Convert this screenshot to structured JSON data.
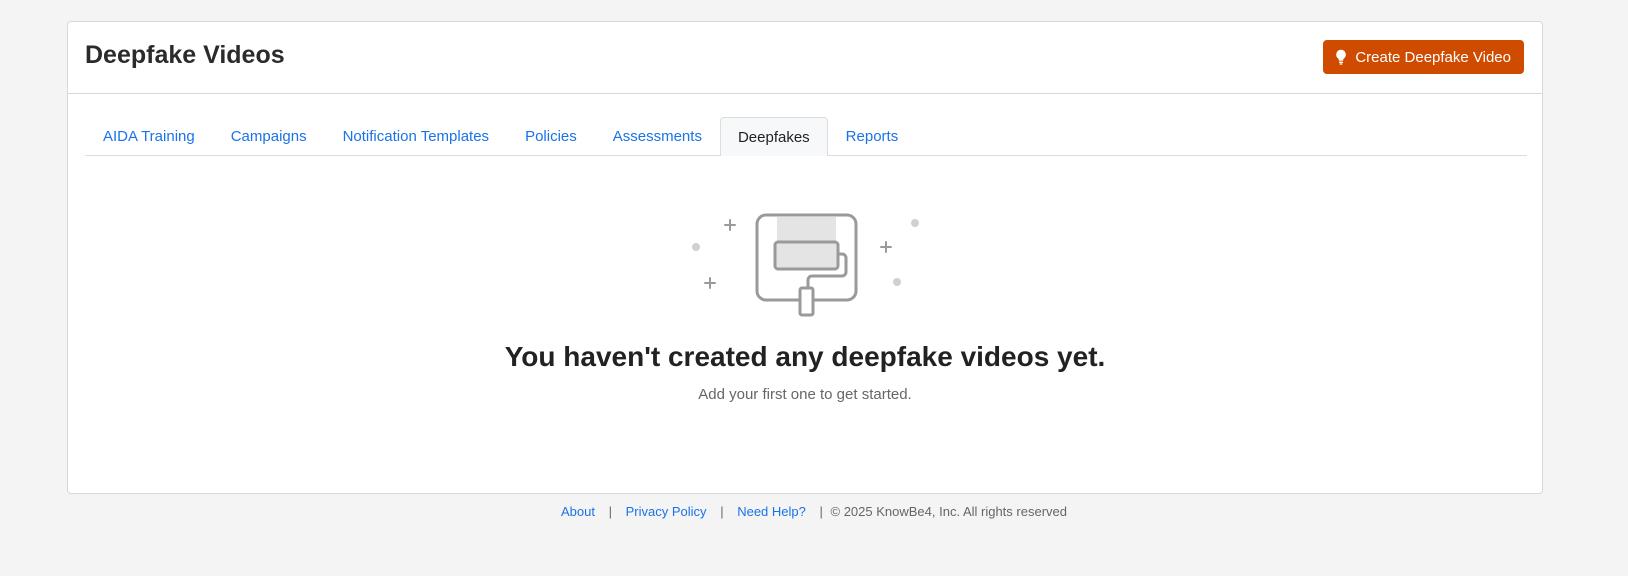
{
  "header": {
    "title": "Deepfake Videos",
    "create_button_label": "Create Deepfake Video",
    "create_button_icon": "lightbulb-icon"
  },
  "tabs": [
    {
      "label": "AIDA Training",
      "active": false
    },
    {
      "label": "Campaigns",
      "active": false
    },
    {
      "label": "Notification Templates",
      "active": false
    },
    {
      "label": "Policies",
      "active": false
    },
    {
      "label": "Assessments",
      "active": false
    },
    {
      "label": "Deepfakes",
      "active": true
    },
    {
      "label": "Reports",
      "active": false
    }
  ],
  "empty_state": {
    "icon": "paint-roller-icon",
    "title": "You haven't created any deepfake videos yet.",
    "subtitle": "Add your first one to get started."
  },
  "footer": {
    "about": "About",
    "privacy": "Privacy Policy",
    "help": "Need Help?",
    "separator": "|",
    "copyright": "© 2025 KnowBe4, Inc. All rights reserved"
  },
  "colors": {
    "accent": "#cf4b00",
    "link": "#1a73e8"
  }
}
